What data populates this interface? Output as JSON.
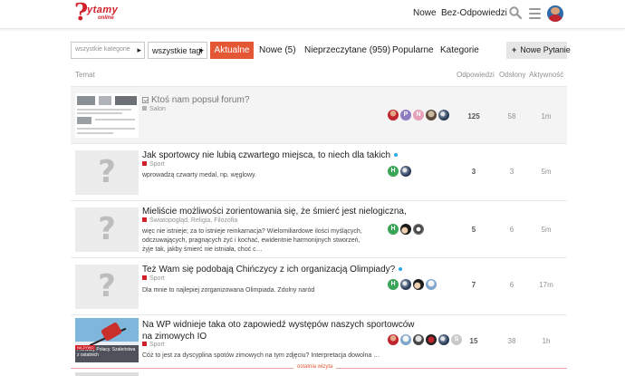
{
  "header": {
    "logo_text": "ytamy",
    "logo_sub": "online",
    "nav": [
      {
        "label": "Nowe"
      },
      {
        "label": "Bez-Odpowiedzi"
      }
    ],
    "icons": [
      "search-icon",
      "menu-icon",
      "user-avatar"
    ]
  },
  "toolbar": {
    "category_dropdown": "wszystkie kategorie",
    "tag_dropdown": "wszystkie tagi",
    "tabs": [
      {
        "label": "Aktualne",
        "active": true
      },
      {
        "label": "Nowe (5)"
      },
      {
        "label": "Nieprzeczytane (959)"
      },
      {
        "label": "Popularne"
      },
      {
        "label": "Kategorie"
      }
    ],
    "new_button": "Nowe Pytanie",
    "new_button_icon": "plus-icon",
    "accent_color": "#e45735"
  },
  "table": {
    "headers": {
      "topic": "Temat",
      "replies": "Odpowiedzi",
      "views": "Odsłony",
      "activity": "Aktywność"
    },
    "rows": [
      {
        "title": "Ktoś nam popsuł forum?",
        "pinned": true,
        "category": "Salon",
        "category_color": "#b3b3b3",
        "excerpt": "",
        "posters": [
          "",
          "P",
          "N",
          "",
          ""
        ],
        "replies": "125",
        "views": "58",
        "activity": "1m"
      },
      {
        "title": "Jak sportowcy nie lubią czwartego miejsca, to niech dla takich",
        "category": "Sport",
        "category_color": "#d1202a",
        "excerpt": "wprowadzą czwarty medal, np. węglowy.",
        "posters": [
          "H",
          ""
        ],
        "replies": "3",
        "views": "3",
        "activity": "5m"
      },
      {
        "title": "Mieliście możliwości zorientowania się, że śmierć jest nielogiczna,",
        "category": "Światopogląd, Religia, Filozofia",
        "category_color": "#d1202a",
        "excerpt": "więc nie istnieje; za to istnieje reinkarnacja? Wielomiliardowe ilości myślących, odczuwających, pragnących żyć i kochać, ewidentnie harmonijnych stworzeń, żyje tak, jakby śmierć nie istniała, choć c…",
        "posters": [
          "H",
          "",
          ""
        ],
        "replies": "5",
        "views": "6",
        "activity": "5m"
      },
      {
        "title": "Też Wam się podobają Chińczycy z ich organizacją Olimpiady?",
        "category": "Sport",
        "category_color": "#d1202a",
        "excerpt": "Dla mnie to najlepiej zorganizowana Olimpiada. Zdolny naród",
        "posters": [
          "H",
          "",
          "",
          ""
        ],
        "replies": "7",
        "views": "6",
        "activity": "17m"
      },
      {
        "title": "Na WP widnieje taka oto zapowiedź występów naszych sportowców",
        "title_line2": "na zimowych IO",
        "category": "Sport",
        "category_color": "#d1202a",
        "excerpt": "Cóż to jest za dyscyplina spotów zimowych na tym zdjęciu? Interpretacja dowolna …",
        "thumb_tag": "NA ŻYWO",
        "thumb_caption": "Pierwszy Polacy. Szaleństwa z ostatnich",
        "posters": [
          "",
          "",
          "",
          "",
          "",
          "S"
        ],
        "replies": "15",
        "views": "38",
        "activity": "1h"
      }
    ]
  },
  "last_visit_label": "ostatnia wizyta"
}
